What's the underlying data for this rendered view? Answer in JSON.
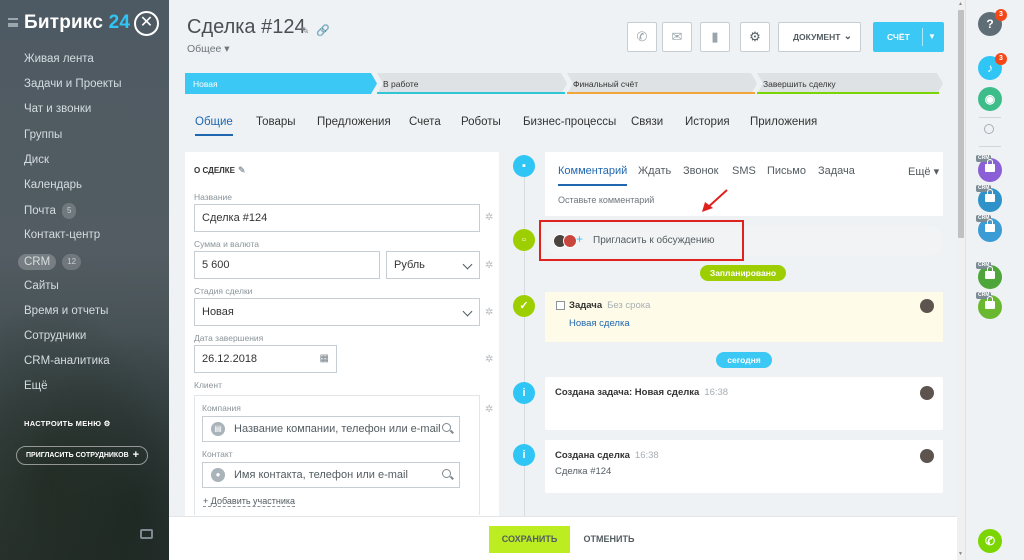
{
  "sidebar": {
    "logo_text": "Битрикс",
    "logo_num": "24",
    "items": [
      {
        "label": "Живая лента"
      },
      {
        "label": "Задачи и Проекты"
      },
      {
        "label": "Чат и звонки"
      },
      {
        "label": "Группы"
      },
      {
        "label": "Диск"
      },
      {
        "label": "Календарь"
      },
      {
        "label": "Почта",
        "count": "5"
      },
      {
        "label": "Контакт-центр"
      },
      {
        "label": "CRM",
        "count": "12"
      },
      {
        "label": "Сайты"
      },
      {
        "label": "Время и отчеты"
      },
      {
        "label": "Сотрудники"
      },
      {
        "label": "CRM-аналитика"
      },
      {
        "label": "Ещё"
      }
    ],
    "setup_menu": "НАСТРОИТЬ МЕНЮ",
    "invite_label": "ПРИГЛАСИТЬ СОТРУДНИКОВ"
  },
  "header": {
    "title": "Сделка #124",
    "category": "Общее",
    "doc_button": "ДОКУМЕНТ",
    "invoice_button": "СЧЁТ"
  },
  "stages": [
    {
      "label": "Новая",
      "color": "#3bc8f5"
    },
    {
      "label": "В работе",
      "color": "#2fc6d5"
    },
    {
      "label": "Финальный счёт",
      "color": "#f2a63a"
    },
    {
      "label": "Завершить сделку",
      "color": "#7bd500"
    }
  ],
  "tabs": [
    "Общие",
    "Товары",
    "Предложения",
    "Счета",
    "Роботы",
    "Бизнес-процессы",
    "Связи",
    "История",
    "Приложения"
  ],
  "form": {
    "section_title": "О СДЕЛКЕ",
    "name_label": "Название",
    "name_value": "Сделка #124",
    "amount_label": "Сумма и валюта",
    "amount_value": "5 600",
    "currency_value": "Рубль",
    "stage_label": "Стадия сделки",
    "stage_value": "Новая",
    "date_label": "Дата завершения",
    "date_value": "26.12.2018",
    "client_label": "Клиент",
    "company_label": "Компания",
    "company_placeholder": "Название компании, телефон или e-mail",
    "contact_label": "Контакт",
    "contact_placeholder": "Имя контакта, телефон или e-mail",
    "add_participant": "+ Добавить участника"
  },
  "timeline": {
    "comment_tabs": [
      "Комментарий",
      "Ждать",
      "Звонок",
      "SMS",
      "Письмо",
      "Задача"
    ],
    "more_tab": "Ещё",
    "comment_placeholder": "Оставьте комментарий",
    "invite_discussion": "Пригласить к обсуждению",
    "planned_badge": "Запланировано",
    "task_title": "Задача",
    "task_deadline": "Без срока",
    "task_link": "Новая сделка",
    "today_badge": "сегодня",
    "event1_title": "Создана задача: Новая сделка",
    "event1_time": "16:38",
    "event2_title": "Создана сделка",
    "event2_time": "16:38",
    "event2_sub": "Сделка #124"
  },
  "footer": {
    "save": "СОХРАНИТЬ",
    "cancel": "ОТМЕНИТЬ"
  },
  "right_panel": {
    "help_badge": "3",
    "notif_badge": "3",
    "crm_tag": "CRM"
  },
  "colors": {
    "accent": "#3bc8f5",
    "save_green": "#bbed21",
    "timeline_green": "#9dcf00",
    "highlight_red": "#e0221f"
  }
}
